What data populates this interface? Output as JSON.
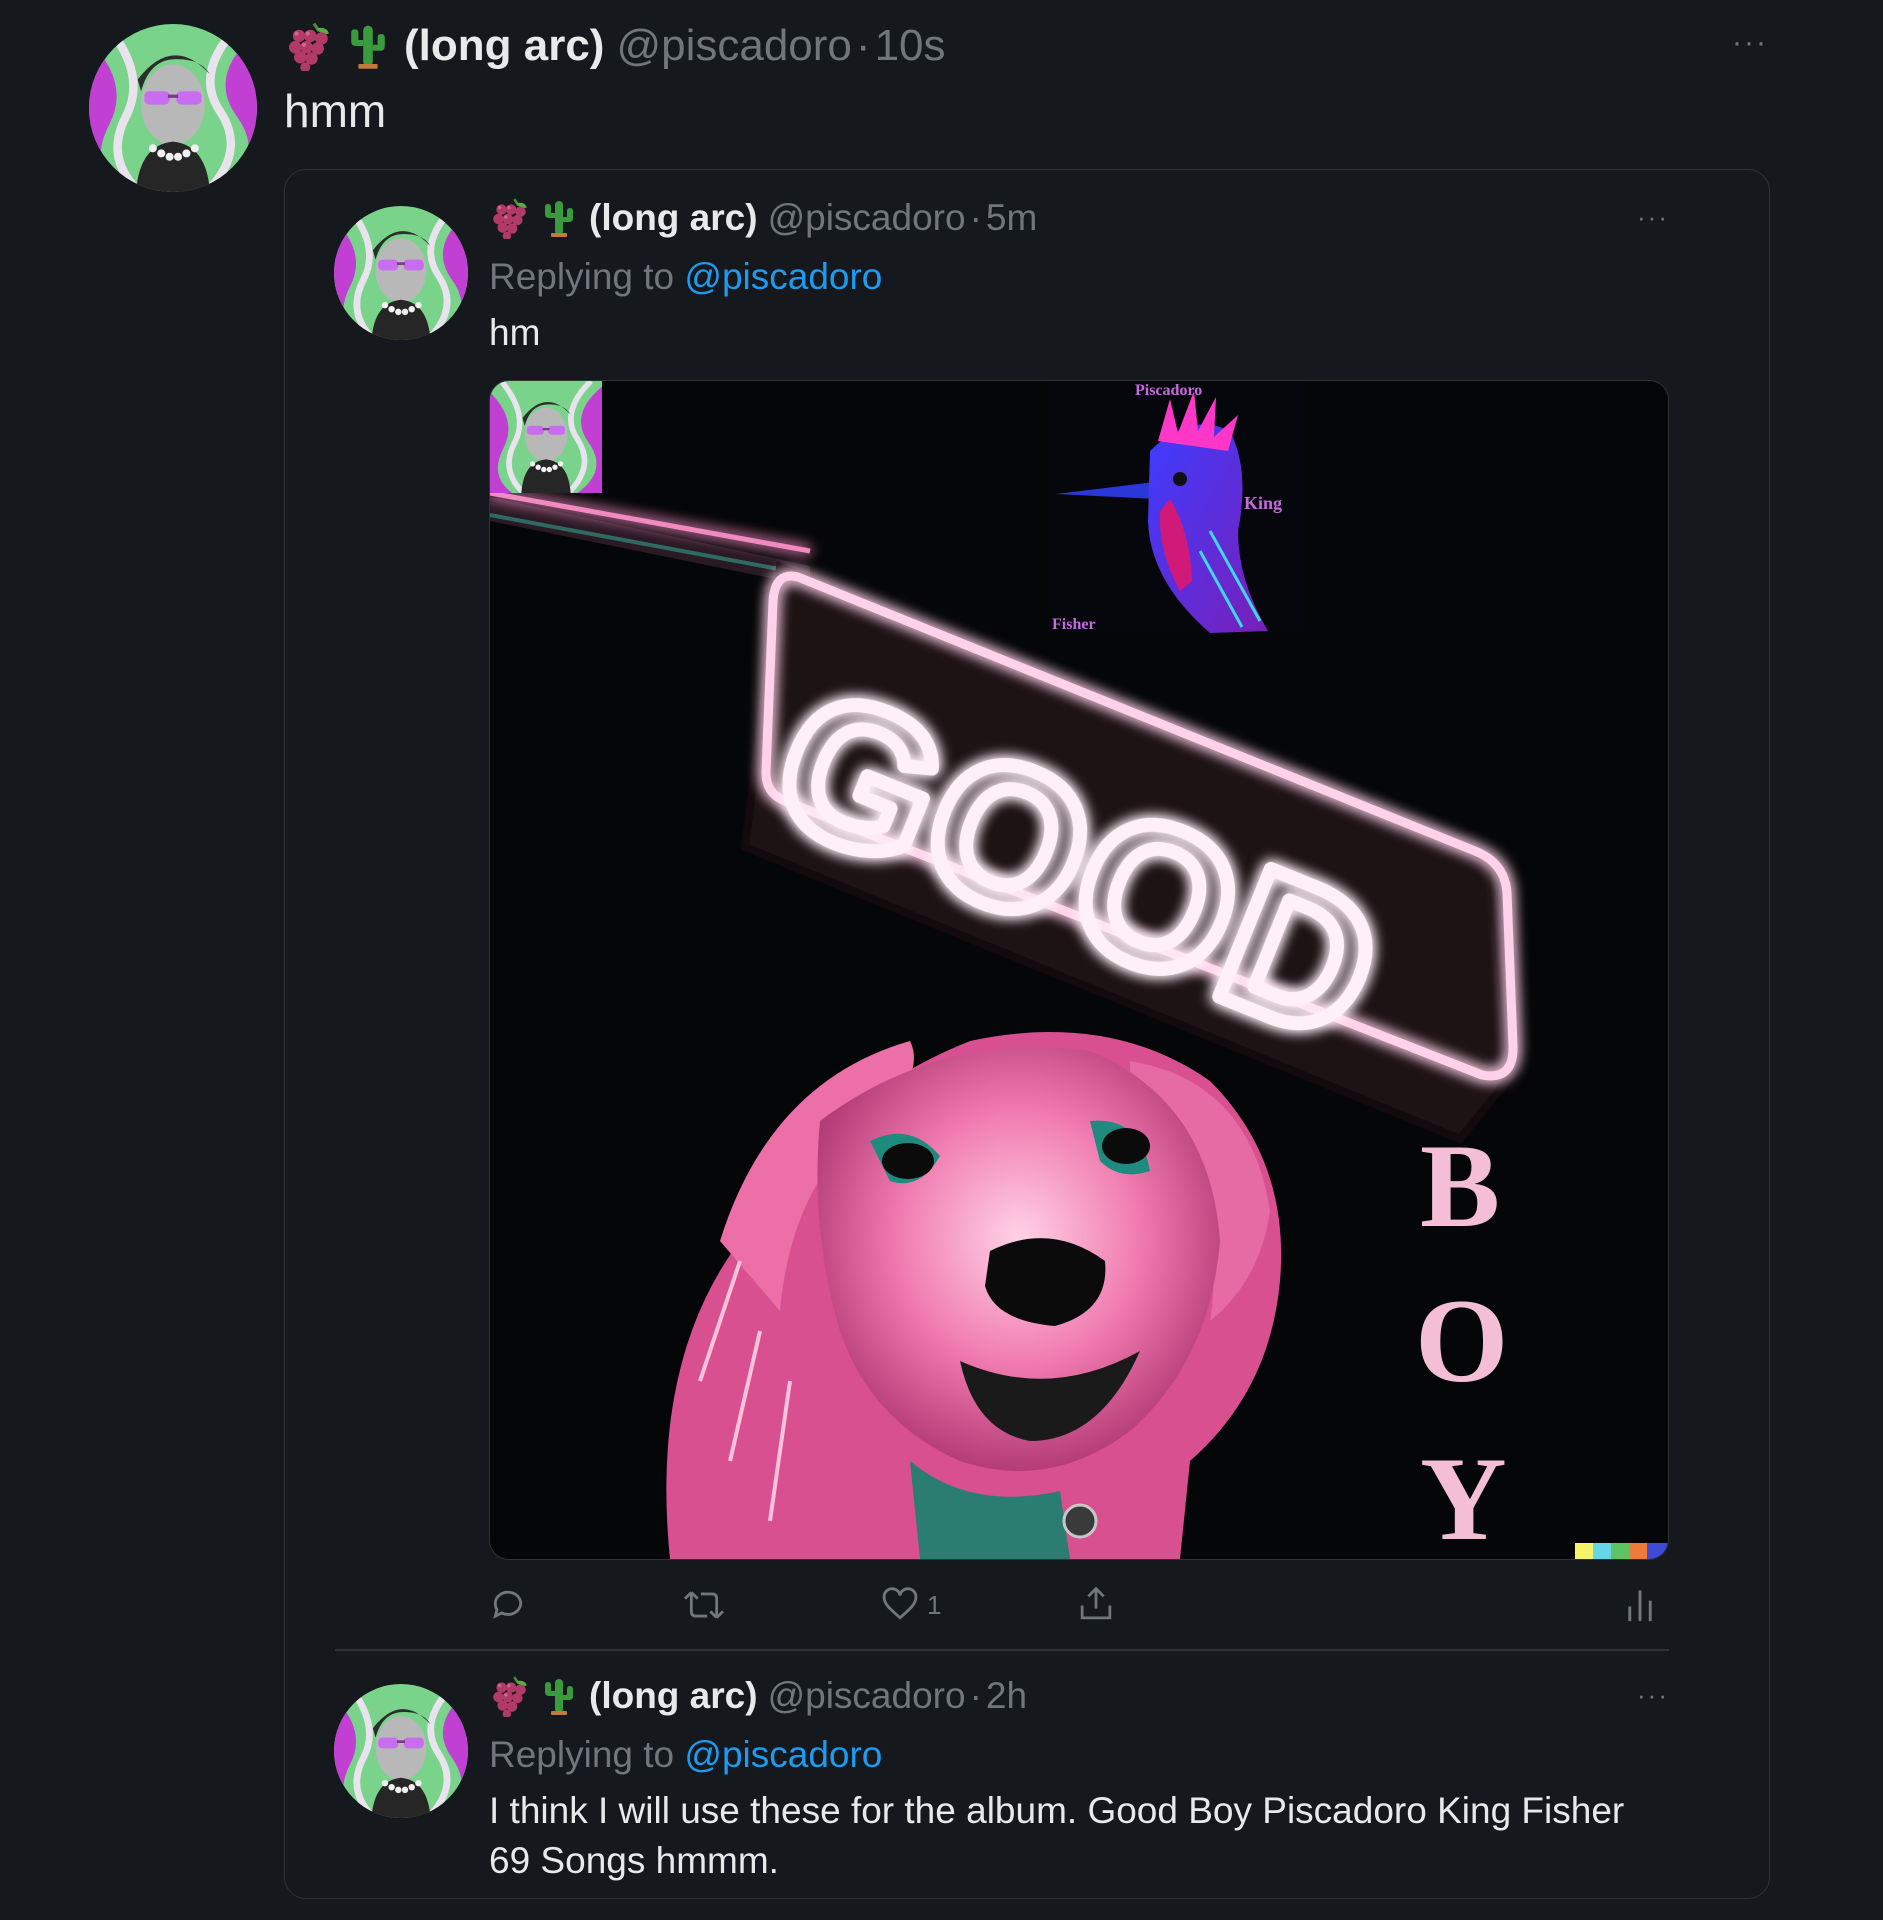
{
  "outer_tweet": {
    "emojis": [
      "grapes-icon",
      "cactus-icon"
    ],
    "display_name": "(long arc)",
    "handle": "@piscadoro",
    "separator": "·",
    "time": "10s",
    "more": "···",
    "text": "hmm"
  },
  "quoted_tweet_1": {
    "display_name": "(long arc)",
    "handle": "@piscadoro",
    "separator": "·",
    "time": "5m",
    "more": "···",
    "replying_prefix": "Replying to",
    "replying_handle": "@piscadoro",
    "text": "hm",
    "image": {
      "sign_text": "GOOD",
      "vertical_letters": [
        "B",
        "O",
        "Y"
      ],
      "inset_labels": {
        "top": "Piscadoro",
        "right": "King",
        "bottom": "Fisher"
      }
    },
    "actions": {
      "like_count": "1"
    }
  },
  "quoted_tweet_2": {
    "display_name": "(long arc)",
    "handle": "@piscadoro",
    "separator": "·",
    "time": "2h",
    "more": "···",
    "replying_prefix": "Replying to",
    "replying_handle": "@piscadoro",
    "text_line1": "I think I will use these for the album. Good Boy Piscadoro King Fisher",
    "text_line2": "69 Songs hmmm."
  },
  "colors": {
    "background": "#15181c",
    "link": "#1d9bf0",
    "muted": "#71767b",
    "neon_pink": "#ff6fb8"
  }
}
